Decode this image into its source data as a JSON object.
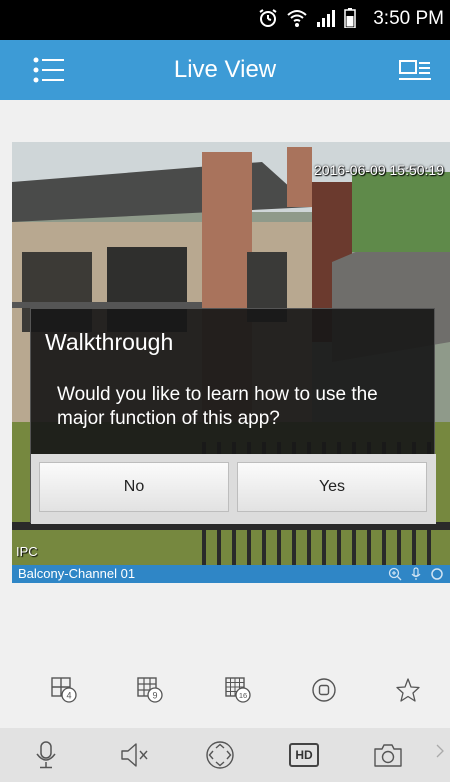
{
  "status_bar": {
    "time": "3:50 PM",
    "icons": [
      "alarm-icon",
      "wifi-icon",
      "signal-icon",
      "battery-icon"
    ]
  },
  "app_bar": {
    "title": "Live View",
    "menu_icon": "menu-list-icon",
    "switch_icon": "camera-list-icon",
    "background_color": "#3d9bd6"
  },
  "video": {
    "timestamp": "2016-06-09 15:50:19",
    "ipc_label": "IPC",
    "channel_name": "Balcony-Channel 01",
    "channel_controls": [
      "zoom-icon",
      "mic-icon",
      "record-indicator-icon"
    ]
  },
  "dialog": {
    "title": "Walkthrough",
    "message": "Would you like to learn how to use the major function of this app?",
    "no_label": "No",
    "yes_label": "Yes"
  },
  "layout_toolbar": {
    "items": [
      "grid-4-icon",
      "grid-9-icon",
      "grid-16-icon",
      "stop-icon",
      "favorite-star-icon"
    ]
  },
  "control_toolbar": {
    "items": [
      "microphone-icon",
      "speaker-mute-icon",
      "ptz-control-icon",
      "hd-icon",
      "snapshot-camera-icon"
    ],
    "hd_label": "HD"
  }
}
